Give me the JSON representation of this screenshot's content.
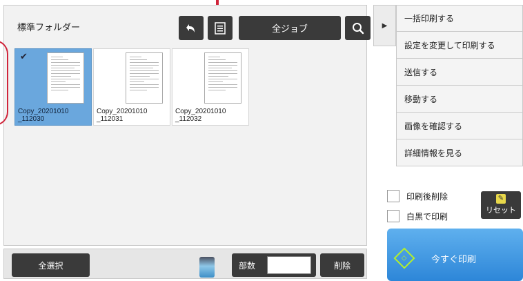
{
  "header": {
    "folder_title": "標準フォルダー",
    "all_jobs_label": "全ジョブ"
  },
  "files": [
    {
      "name": "Copy_20201010\n_112030",
      "selected": true
    },
    {
      "name": "Copy_20201010\n_112031",
      "selected": false
    },
    {
      "name": "Copy_20201010\n_112032",
      "selected": false
    }
  ],
  "bottom": {
    "select_all": "全選択",
    "copies_label": "部数",
    "copies_value": "",
    "delete": "削除"
  },
  "actions": [
    "一括印刷する",
    "設定を変更して印刷する",
    "送信する",
    "移動する",
    "画像を確認する",
    "詳細情報を見る"
  ],
  "options": {
    "delete_after_print": "印刷後削除",
    "bw_print": "白黒で印刷"
  },
  "reset_label": "リセット",
  "print_now": "今すぐ印刷",
  "icons": {
    "up": "up-folder-icon",
    "list": "list-view-icon",
    "search": "search-icon",
    "collapse": "collapse-panel-icon",
    "start": "start-icon",
    "reset": "reset-icon",
    "toner": "toner-icon"
  },
  "colors": {
    "accent": "#2d86d8",
    "selected": "#6aa7dd",
    "marker": "#d0243a",
    "start_icon": "#b4f02a"
  }
}
